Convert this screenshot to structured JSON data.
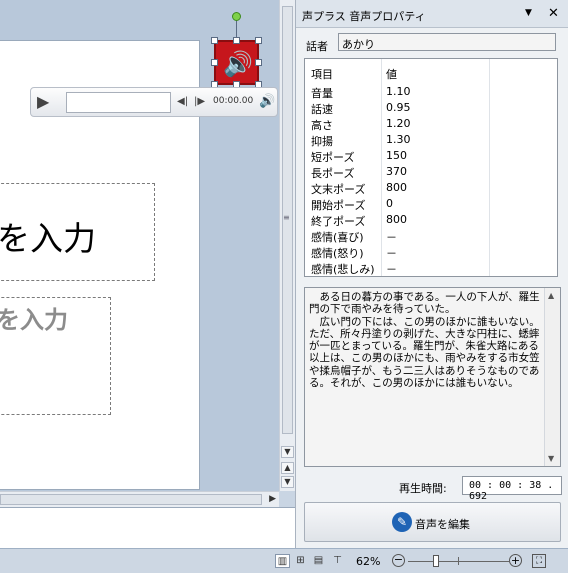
{
  "slide": {
    "title_placeholder": "を入力",
    "subtitle_placeholder": "を入力"
  },
  "media_bar": {
    "time": "00:00.00",
    "icons": {
      "play": "play-icon",
      "prev": "skip-back-icon",
      "next": "skip-forward-icon",
      "volume": "volume-icon"
    }
  },
  "panel": {
    "title": "声プラス 音声プロパティ",
    "speaker_label": "話者",
    "speaker_value": "あかり",
    "table_header": {
      "item": "項目",
      "value": "値"
    },
    "properties": [
      {
        "name": "音量",
        "value": "1.10"
      },
      {
        "name": "話速",
        "value": "0.95"
      },
      {
        "name": "高さ",
        "value": "1.20"
      },
      {
        "name": "抑揚",
        "value": "1.30"
      },
      {
        "name": "短ポーズ",
        "value": "150"
      },
      {
        "name": "長ポーズ",
        "value": "370"
      },
      {
        "name": "文末ポーズ",
        "value": "800"
      },
      {
        "name": "開始ポーズ",
        "value": "0"
      },
      {
        "name": "終了ポーズ",
        "value": "800"
      },
      {
        "name": "感情(喜び)",
        "value": "－"
      },
      {
        "name": "感情(怒り)",
        "value": "－"
      },
      {
        "name": "感情(悲しみ)",
        "value": "－"
      }
    ],
    "text": "　ある日の暮方の事である。一人の下人が、羅生門の下で雨やみを待っていた。\n　広い門の下には、この男のほかに誰もいない。ただ、所々丹塗りの剥げた、大きな円柱に、蟋蟀が一匹とまっている。羅生門が、朱雀大路にある以上は、この男のほかにも、雨やみをする市女笠や揉烏帽子が、もう二三人はありそうなものである。それが、この男のほかには誰もいない。",
    "duration_label": "再生時間:",
    "duration_value": "00 : 00 : 38 . 692",
    "edit_button": "音声を編集"
  },
  "status_bar": {
    "zoom": "62%",
    "zoom_fraction": 0.62
  }
}
